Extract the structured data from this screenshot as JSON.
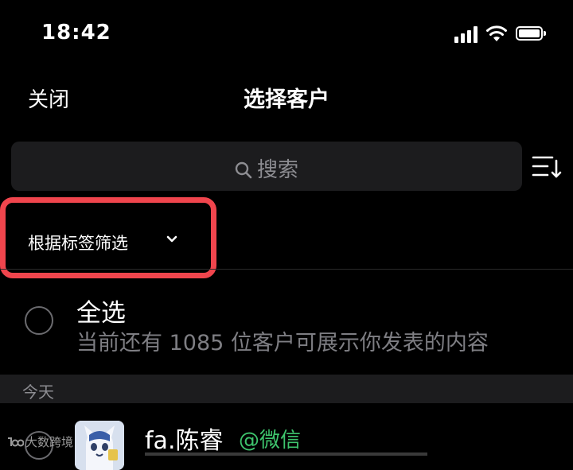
{
  "status_bar": {
    "time": "18:42"
  },
  "nav": {
    "close_label": "关闭",
    "title": "选择客户"
  },
  "search": {
    "placeholder": "搜索"
  },
  "filter": {
    "tag_filter_label": "根据标签筛选"
  },
  "select_all": {
    "label": "全选",
    "subtitle": "当前还有 1085 位客户可展示你发表的内容"
  },
  "sections": [
    {
      "header": "今天",
      "contacts": [
        {
          "name": "fa.陈睿",
          "tag": "@微信"
        }
      ]
    }
  ],
  "watermark": {
    "text": "大数跨境"
  },
  "colors": {
    "background": "#000000",
    "highlight_border": "#f0454d",
    "tag_green": "#3ec46d",
    "secondary_text": "#7e7e83"
  }
}
